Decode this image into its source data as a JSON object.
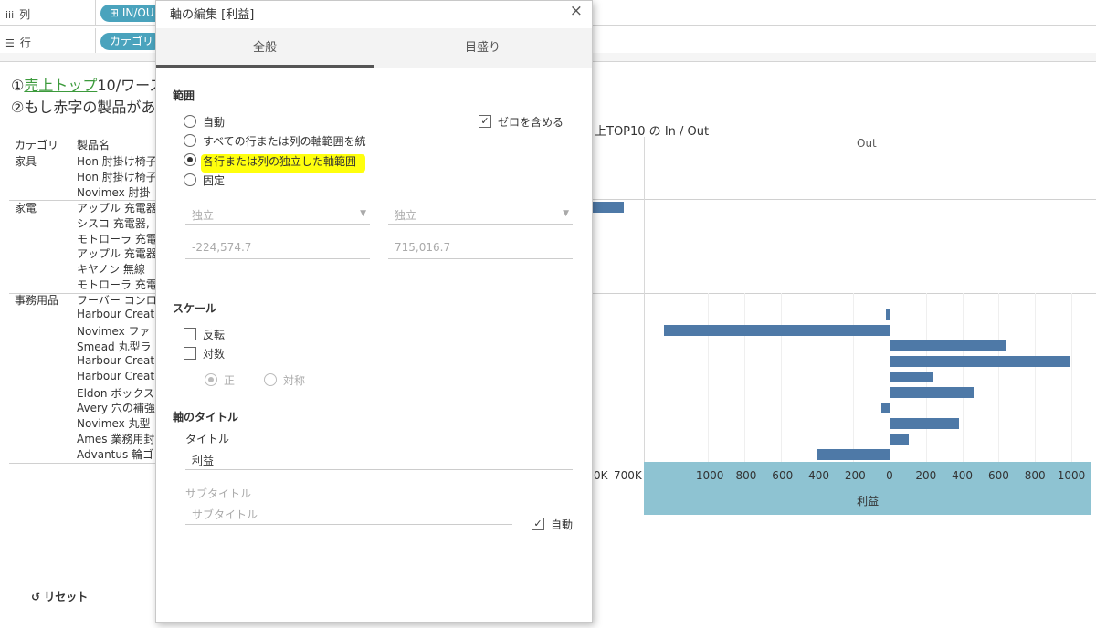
{
  "shelves": {
    "columns_label": "列",
    "columns_pill": "⊞ IN/OU",
    "rows_label": "行",
    "rows_pill": "カテゴリ"
  },
  "worksheet": {
    "line1_prefix": "①",
    "line1_highlight": "売上トップ",
    "line1_rest": "10/ワース",
    "line2": "②もし赤字の製品がある",
    "header_category": "カテゴリ",
    "header_product": "製品名",
    "chart_title": "上TOP10 の In / Out",
    "out_label": "Out",
    "groups": [
      {
        "category": "家具",
        "products": [
          "Hon 肘掛け椅子",
          "Hon 肘掛け椅子",
          "Novimex 肘掛"
        ]
      },
      {
        "category": "家電",
        "products": [
          "アップル 充電器",
          "シスコ 充電器,",
          "モトローラ 充電",
          "アップル 充電器",
          "キヤノン 無線",
          "モトローラ 充電"
        ]
      },
      {
        "category": "事務用品",
        "products": [
          "フーバー コンロ",
          "Harbour Creat",
          "Novimex ファ",
          "Smead 丸型ラ",
          "Harbour Creat",
          "Harbour Creat",
          "Eldon ボックス",
          "Avery 穴の補強",
          "Novimex 丸型",
          "Ames 業務用封",
          "Advantus 輪ゴ"
        ]
      }
    ],
    "left_axis_ticks": [
      "0K",
      "700K"
    ]
  },
  "chart_data": {
    "type": "bar",
    "orientation": "horizontal",
    "xlabel": "利益",
    "xlim": [
      -1250,
      1100
    ],
    "xticks": [
      -1000,
      -800,
      -600,
      -400,
      -200,
      0,
      200,
      400,
      600,
      800,
      1000
    ],
    "xtick_labels": [
      "-1000",
      "-800",
      "-600",
      "-400",
      "-200",
      "0",
      "200",
      "400",
      "600",
      "800",
      "1000"
    ],
    "series": [
      {
        "values": [
          -20,
          -1240,
          640,
          995,
          240,
          460,
          -45,
          380,
          105,
          -400
        ]
      }
    ],
    "bar_color": "#4e79a7"
  },
  "dialog": {
    "title": "軸の編集 [利益]",
    "close_glyph": "×",
    "tabs": [
      "全般",
      "目盛り"
    ],
    "range_heading": "範囲",
    "range_options": [
      "自動",
      "すべての行または列の軸範囲を統一",
      "各行または列の独立した軸範囲",
      "固定"
    ],
    "selected_range": 2,
    "include_zero": "ゼロを含める",
    "dropdown1": "独立",
    "dropdown2": "独立",
    "min_value": "-224,574.7",
    "max_value": "715,016.7",
    "scale_heading": "スケール",
    "reverse": "反転",
    "logarithmic": "対数",
    "positive": "正",
    "symmetric": "対称",
    "axis_title_heading": "軸のタイトル",
    "title_label": "タイトル",
    "title_value": "利益",
    "subtitle_label": "サブタイトル",
    "subtitle_placeholder": "サブタイトル",
    "auto": "自動",
    "reset": "リセット",
    "reset_icon": "↺",
    "highlight_color": "#ffff00"
  }
}
